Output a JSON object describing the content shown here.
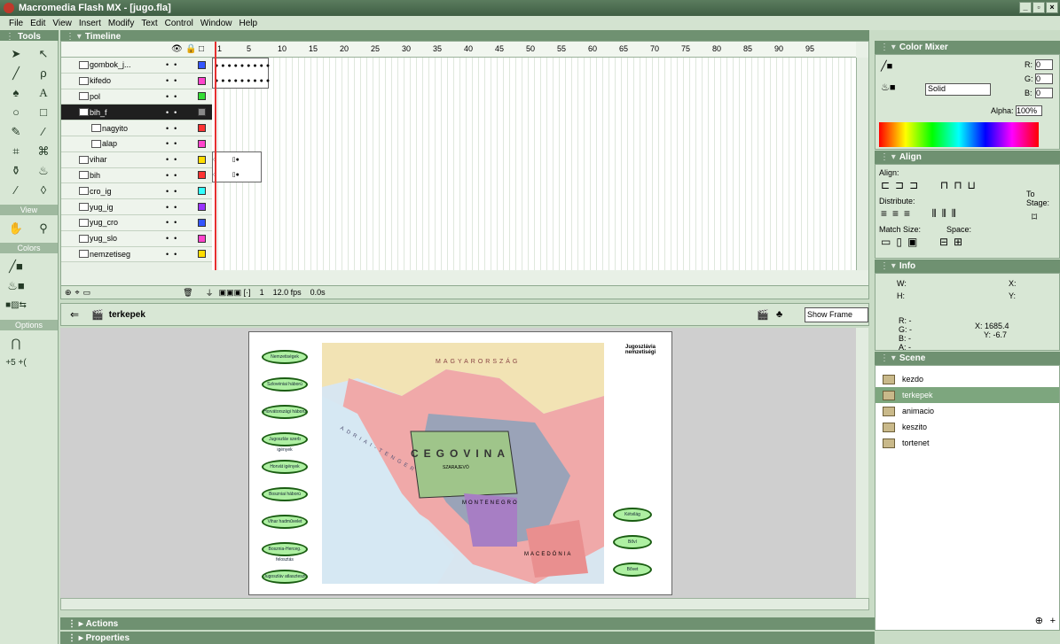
{
  "window": {
    "title": "Macromedia Flash MX - [jugo.fla]"
  },
  "menu": [
    "File",
    "Edit",
    "View",
    "Insert",
    "Modify",
    "Text",
    "Control",
    "Window",
    "Help"
  ],
  "panels": {
    "tools": "Tools",
    "timeline": "Timeline",
    "color_mixer": "Color Mixer",
    "align": "Align",
    "info": "Info",
    "scene": "Scene",
    "actions": "Actions",
    "properties": "Properties"
  },
  "tools": {
    "view_label": "View",
    "colors_label": "Colors",
    "options_label": "Options"
  },
  "timeline": {
    "frame_numbers": [
      "1",
      "5",
      "10",
      "15",
      "20",
      "25",
      "30",
      "35",
      "40",
      "45",
      "50",
      "55",
      "60",
      "65",
      "70",
      "75",
      "80",
      "85",
      "90",
      "95"
    ],
    "layers": [
      {
        "name": "gombok_j...",
        "child": false,
        "color": "#3355ff"
      },
      {
        "name": "kifedo",
        "child": false,
        "color": "#ff44cc"
      },
      {
        "name": "pol",
        "child": false,
        "color": "#33dd33"
      },
      {
        "name": "bih_f",
        "child": false,
        "color": "#888888",
        "selected": true
      },
      {
        "name": "nagyito",
        "child": true,
        "color": "#ff3333"
      },
      {
        "name": "alap",
        "child": true,
        "color": "#ff44cc"
      },
      {
        "name": "vihar",
        "child": false,
        "color": "#ffdd00"
      },
      {
        "name": "bih",
        "child": false,
        "color": "#ff3333"
      },
      {
        "name": "cro_ig",
        "child": false,
        "color": "#33ffff"
      },
      {
        "name": "yug_ig",
        "child": false,
        "color": "#9933ff"
      },
      {
        "name": "yug_cro",
        "child": false,
        "color": "#3355ff"
      },
      {
        "name": "yug_slo",
        "child": false,
        "color": "#ff44cc"
      },
      {
        "name": "nemzetiseg",
        "child": false,
        "color": "#ffdd00"
      }
    ],
    "current_frame": "1",
    "fps": "12.0 fps",
    "time": "0.0s"
  },
  "editbar": {
    "scene_name": "terkepek",
    "show_frame": "Show Frame"
  },
  "stage": {
    "buttons_left": [
      "Nemzetiségek",
      "Szlovéniai háború",
      "Horvátországi háború",
      "Jugoszláv szerb igények",
      "Horvát igények",
      "Boszniai háború",
      "Vihar hadművelet",
      "Bosznia-Herceg. felosztás",
      "Jugoszláv atlaszteszt"
    ],
    "buttons_right": [
      "Kétvilág",
      "Bőví",
      "Bővet"
    ],
    "map_labels": [
      "MAGYARORSZÁG",
      "CEGOVINA",
      "SZARAJEVÓ",
      "MONTENEGRO",
      "MACEDÓNIA",
      "ADRIAI-TENGER"
    ],
    "legend_title": "Jugoszlávia nemzetiségi"
  },
  "color_mixer": {
    "r": "0",
    "g": "0",
    "b": "0",
    "fill": "Solid",
    "alpha": "100%",
    "r_label": "R:",
    "g_label": "G:",
    "b_label": "B:",
    "alpha_label": "Alpha:"
  },
  "align": {
    "align_label": "Align:",
    "distribute_label": "Distribute:",
    "match_label": "Match Size:",
    "space_label": "Space:",
    "to_stage": "To Stage:"
  },
  "info": {
    "w": "W:",
    "h": "H:",
    "x": "X:",
    "y": "Y:",
    "r": "R: -",
    "g": "G: -",
    "b": "B: -",
    "a": "A: -",
    "x_val": "X: 1685.4",
    "y_val": "Y: -6.7"
  },
  "scenes": [
    {
      "name": "kezdo"
    },
    {
      "name": "terkepek",
      "selected": true
    },
    {
      "name": "animacio"
    },
    {
      "name": "keszito"
    },
    {
      "name": "tortenet"
    }
  ]
}
